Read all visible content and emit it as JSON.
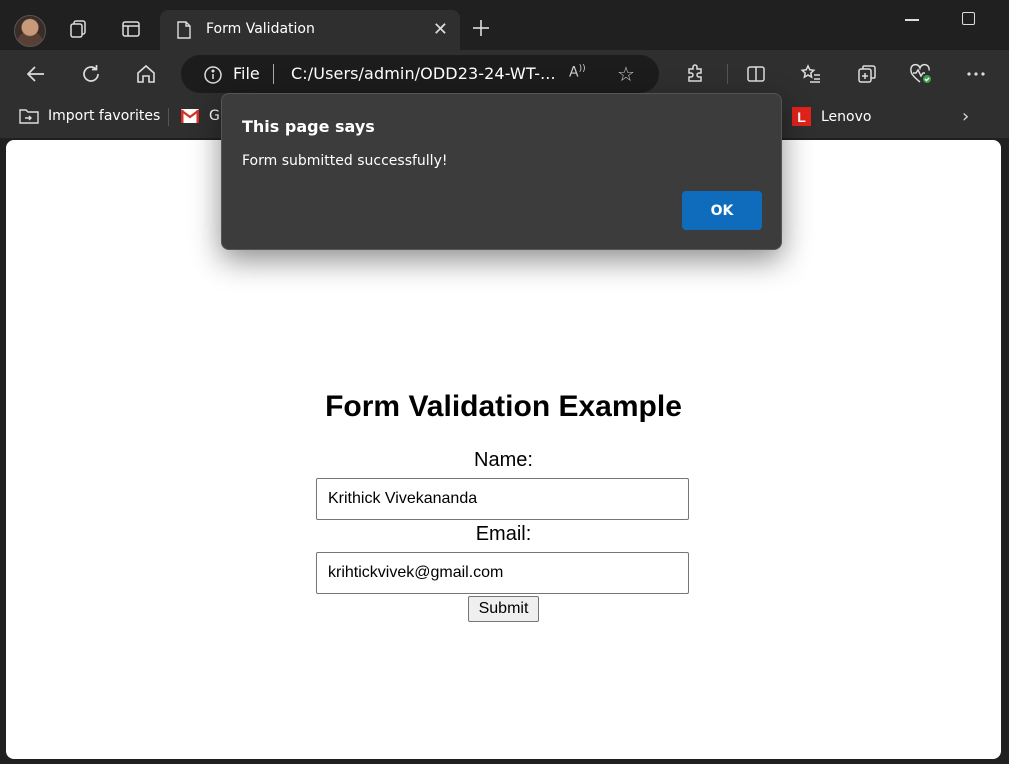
{
  "browser": {
    "tab": {
      "title": "Form Validation"
    },
    "address": {
      "scheme_label": "File",
      "url": "C:/Users/admin/ODD23-24-WT-..."
    },
    "favorites": {
      "import_label": "Import favorites",
      "gmail_label": "G",
      "lenovo_label": "Lenovo",
      "lenovo_logo_letter": "L"
    }
  },
  "page": {
    "heading": "Form Validation Example",
    "name_label": "Name:",
    "name_value": "Krithick Vivekananda",
    "email_label": "Email:",
    "email_value": "krihtickvivek@gmail.com",
    "submit_label": "Submit"
  },
  "dialog": {
    "title": "This page says",
    "message": "Form submitted successfully!",
    "ok_label": "OK"
  },
  "colors": {
    "accent": "#0f6cbd",
    "lenovo": "#e2231a"
  }
}
